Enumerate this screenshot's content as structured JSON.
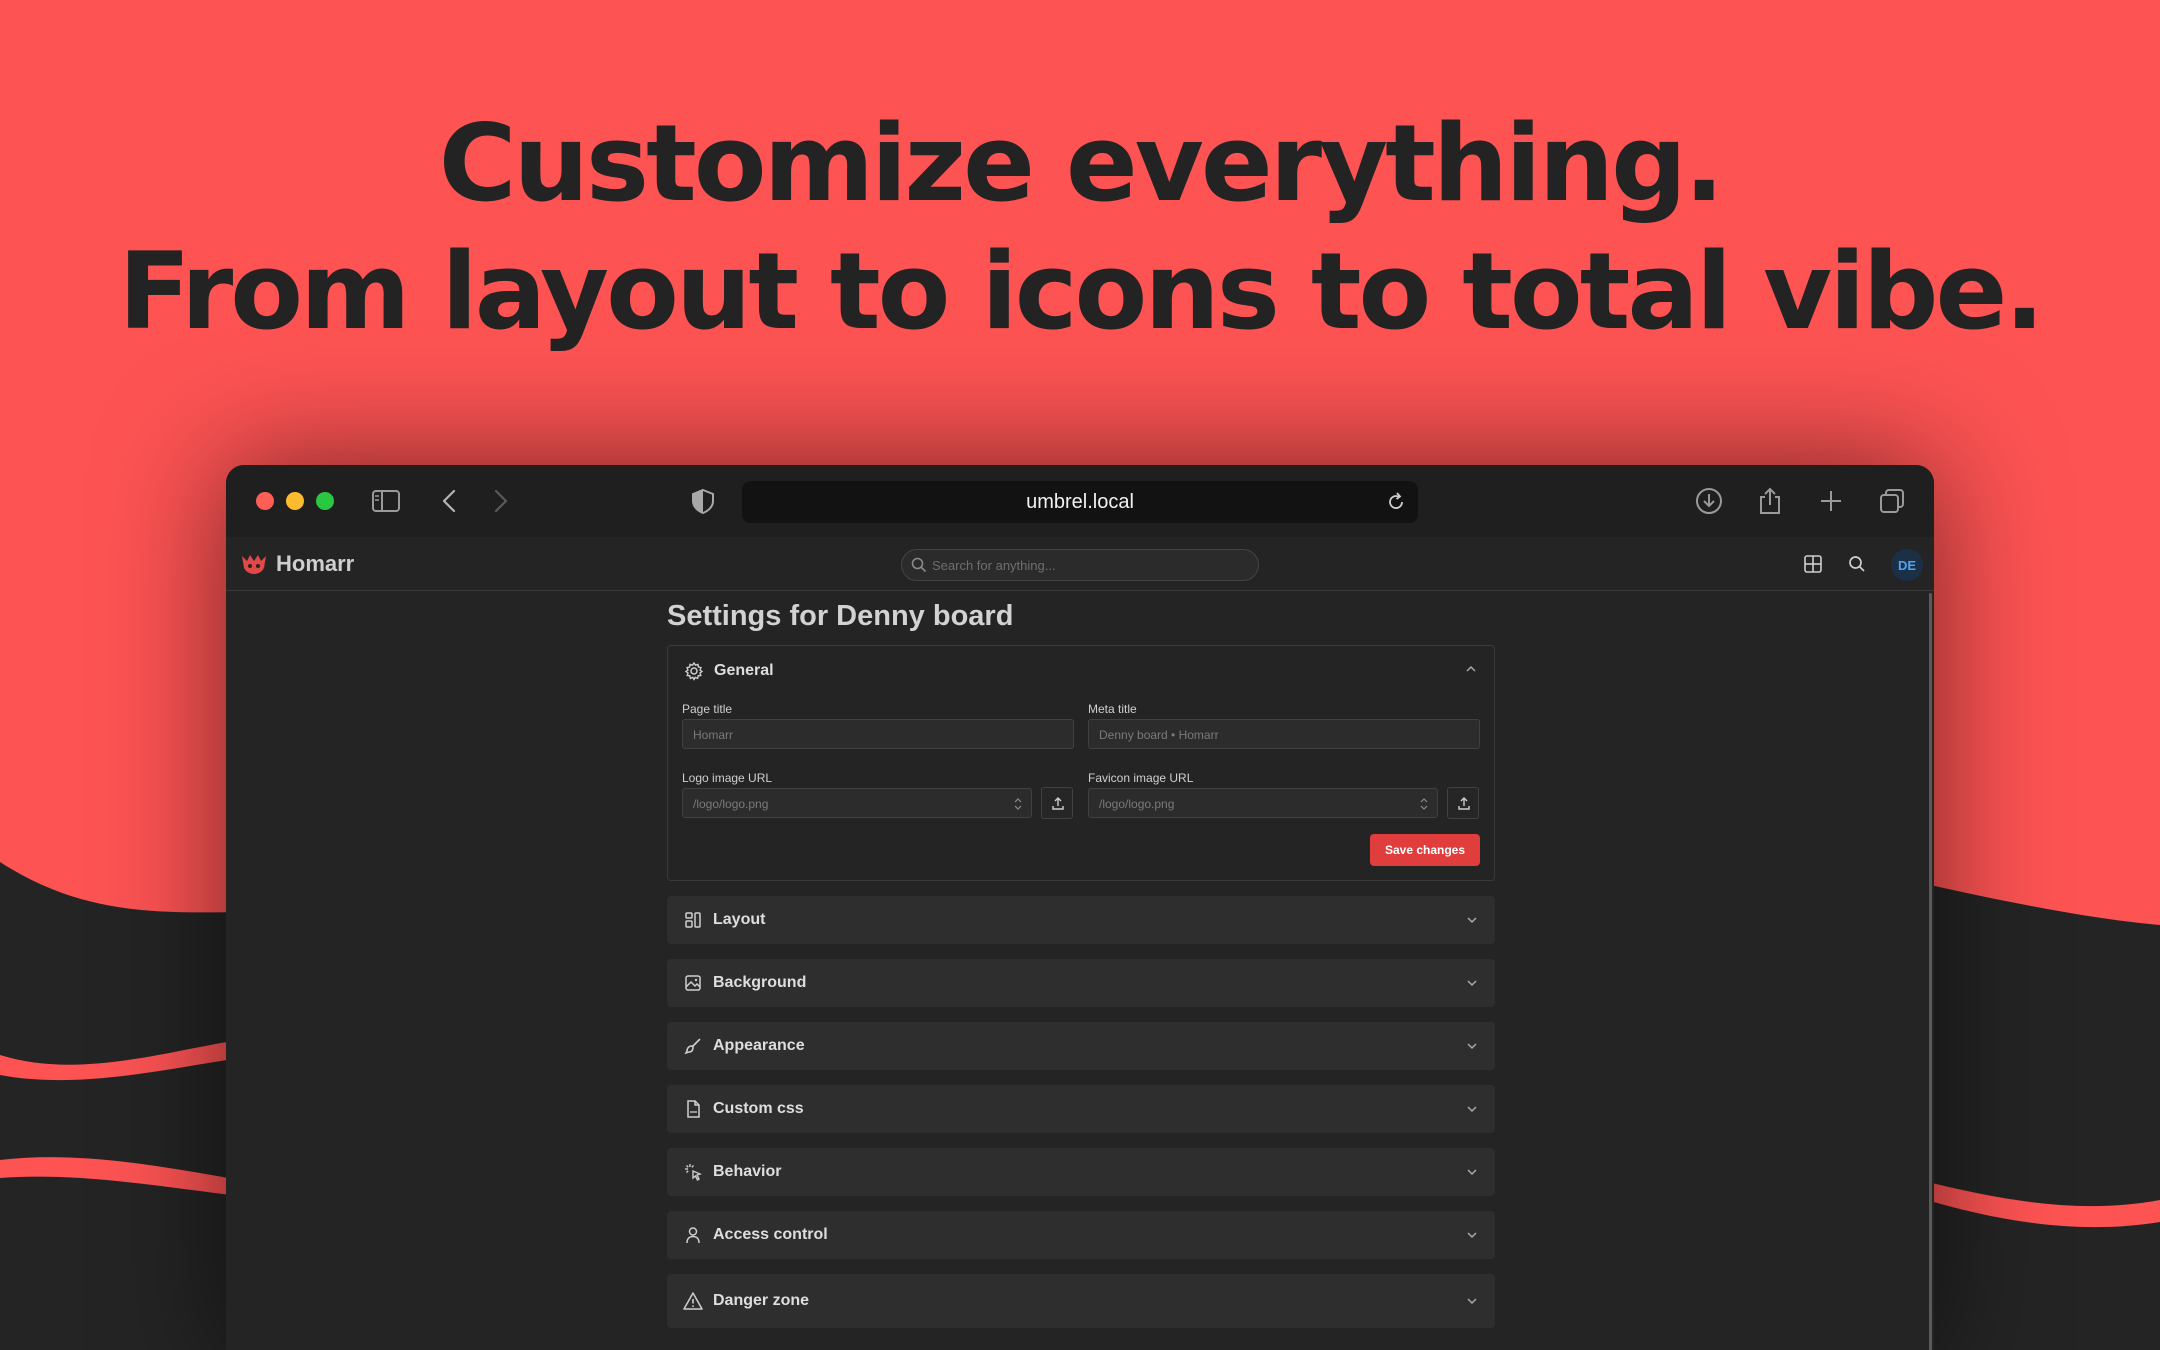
{
  "headline": {
    "line1": "Customize everything.",
    "line2": "From layout to icons to total vibe."
  },
  "browser": {
    "url": "umbrel.local",
    "icons": [
      "sidebar-icon",
      "back-icon",
      "forward-icon",
      "shield-icon",
      "reload-icon",
      "download-icon",
      "share-icon",
      "new-tab-icon",
      "tabs-overview-icon"
    ]
  },
  "app": {
    "name": "Homarr",
    "search_placeholder": "Search for anything...",
    "avatar_initials": "DE"
  },
  "page": {
    "title": "Settings for Denny board"
  },
  "general": {
    "label": "General",
    "page_title_label": "Page title",
    "page_title_value": "Homarr",
    "meta_title_label": "Meta title",
    "meta_title_value": "Denny board • Homarr",
    "logo_label": "Logo image URL",
    "logo_value": "/logo/logo.png",
    "favicon_label": "Favicon image URL",
    "favicon_value": "/logo/logo.png",
    "save_label": "Save changes"
  },
  "sections": [
    {
      "label": "Layout",
      "icon": "layout-icon"
    },
    {
      "label": "Background",
      "icon": "image-icon"
    },
    {
      "label": "Appearance",
      "icon": "brush-icon"
    },
    {
      "label": "Custom css",
      "icon": "css-file-icon"
    },
    {
      "label": "Behavior",
      "icon": "pointer-icon"
    },
    {
      "label": "Access control",
      "icon": "user-icon"
    },
    {
      "label": "Danger zone",
      "icon": "warning-icon"
    }
  ],
  "colors": {
    "brand_red": "#fd5353",
    "dark": "#232323",
    "accent_button": "#e03d3d"
  }
}
